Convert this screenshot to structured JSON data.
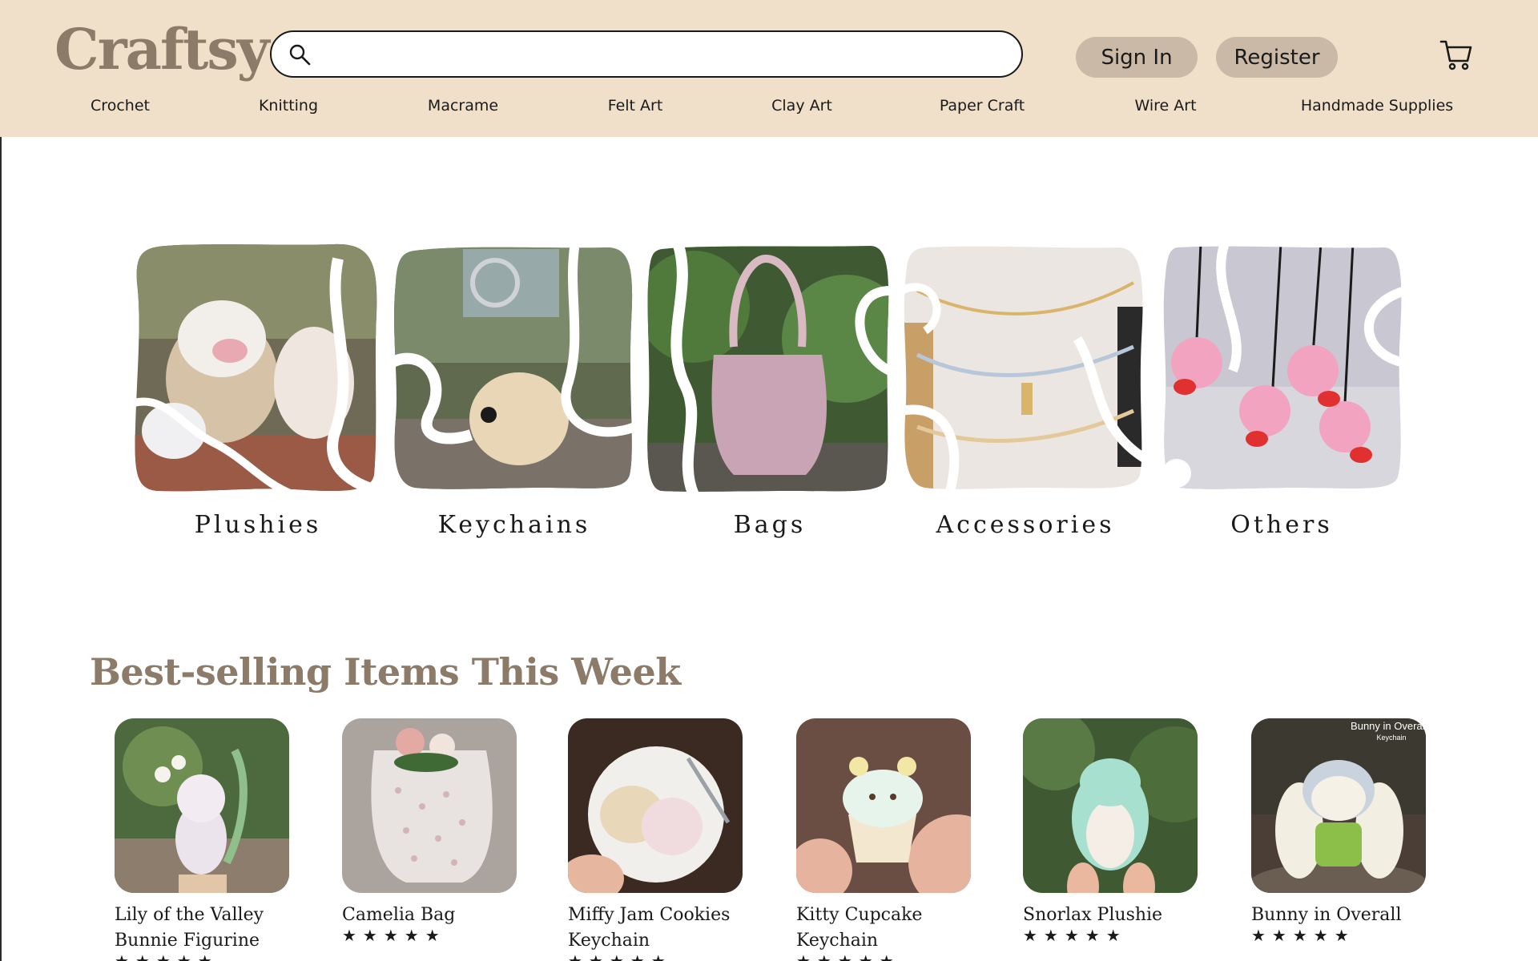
{
  "header": {
    "logo": "Craftsy",
    "search": {
      "placeholder": "",
      "value": ""
    },
    "sign_in_label": "Sign In",
    "register_label": "Register",
    "cart_icon": "cart-icon",
    "search_icon": "search-icon"
  },
  "nav": {
    "items": [
      {
        "label": "Crochet"
      },
      {
        "label": "Knitting"
      },
      {
        "label": "Macrame"
      },
      {
        "label": "Felt Art"
      },
      {
        "label": "Clay Art"
      },
      {
        "label": "Paper Craft"
      },
      {
        "label": "Wire Art"
      },
      {
        "label": "Handmade Supplies"
      }
    ]
  },
  "categories": [
    {
      "label": "Plushies"
    },
    {
      "label": "Keychains"
    },
    {
      "label": "Bags"
    },
    {
      "label": "Accessories"
    },
    {
      "label": "Others"
    }
  ],
  "best_selling": {
    "title": "Best-selling Items This Week",
    "items": [
      {
        "name": "Lily of the Valley Bunnie Figurine",
        "rating": 5
      },
      {
        "name": "Camelia Bag",
        "rating": 5
      },
      {
        "name": "Miffy Jam Cookies Keychain",
        "rating": 5
      },
      {
        "name": "Kitty Cupcake Keychain",
        "rating": 5
      },
      {
        "name": "Snorlax Plushie",
        "rating": 5
      },
      {
        "name": "Bunny in Overall",
        "rating": 5,
        "image_caption": "Bunny in Overalls",
        "image_subcaption": "Keychain"
      }
    ]
  },
  "colors": {
    "header_bg": "#f0dfc9",
    "brand": "#8c7b68",
    "button_bg": "#c9b9a6"
  }
}
